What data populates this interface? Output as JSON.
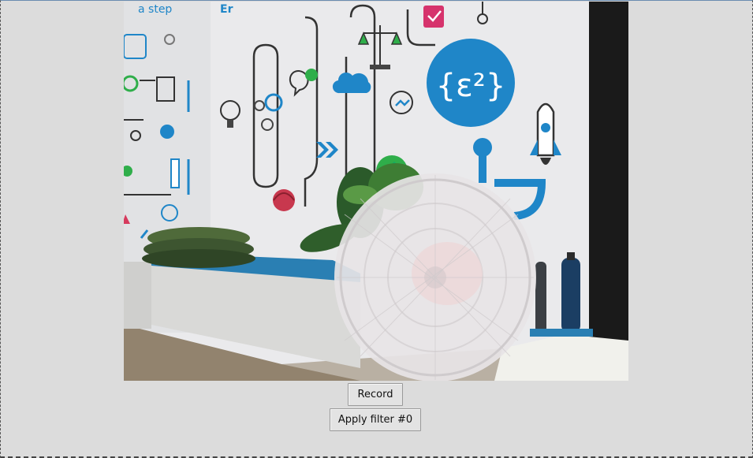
{
  "controls": {
    "record_label": "Record",
    "filter_label": "Apply filter #0"
  },
  "video": {
    "wall_logo": "{ε²}",
    "wall_text_top_left": "a step",
    "colors": {
      "accent_blue": "#1f86c8",
      "bench_blue": "#2a7fb3",
      "wall": "#ececee",
      "floor": "#8f8069"
    }
  }
}
